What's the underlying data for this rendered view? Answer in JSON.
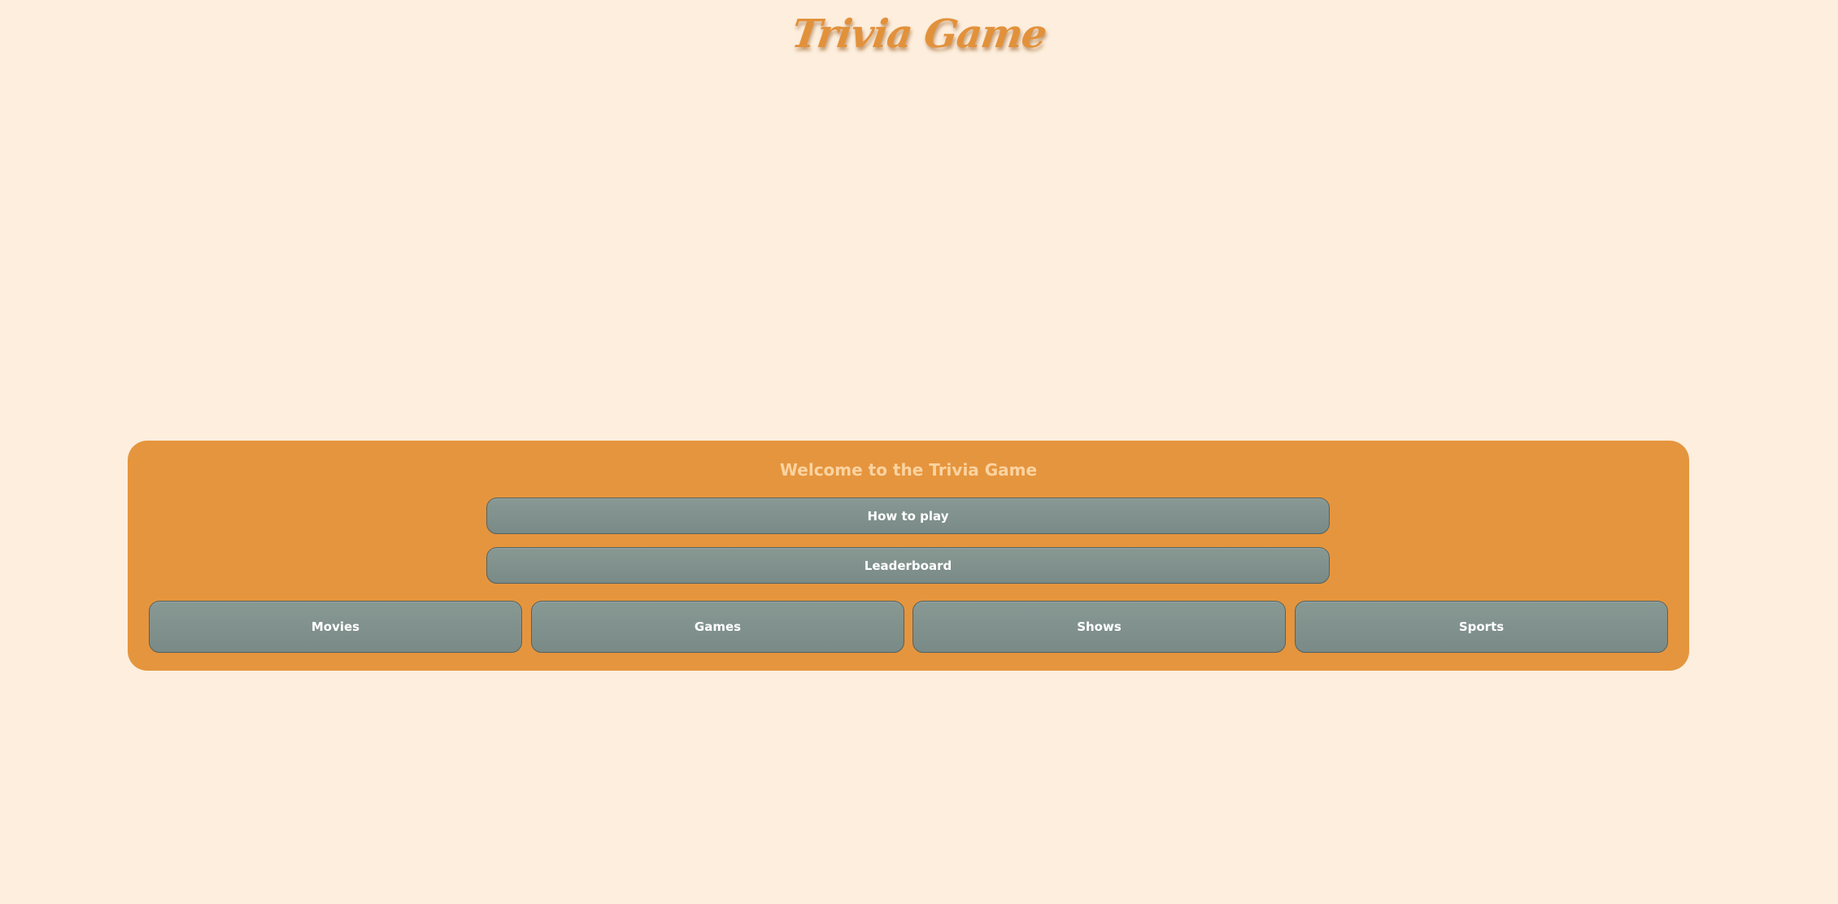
{
  "header": {
    "title": "Trivia Game"
  },
  "menu": {
    "welcome": "Welcome to the Trivia Game",
    "how_to_play_label": "How to play",
    "leaderboard_label": "Leaderboard"
  },
  "categories": [
    {
      "label": "Movies"
    },
    {
      "label": "Games"
    },
    {
      "label": "Shows"
    },
    {
      "label": "Sports"
    }
  ],
  "colors": {
    "page_background": "#fdeedd",
    "panel_background": "#e5953e",
    "title": "#e2913b",
    "welcome_text": "#fbd3a0",
    "button_background": "#83938f",
    "button_border": "#56625f",
    "button_text": "#ffffff"
  }
}
